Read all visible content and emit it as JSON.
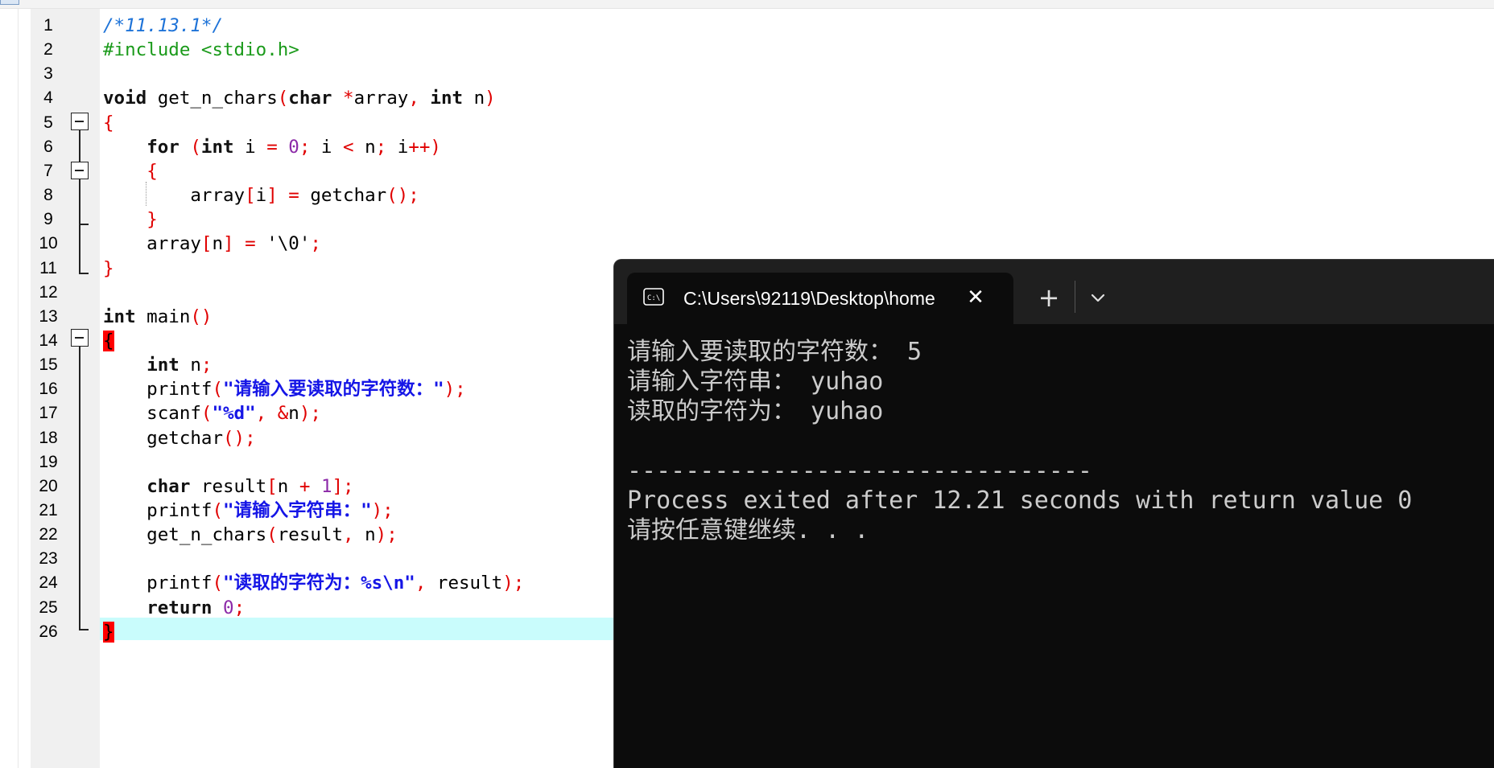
{
  "editor": {
    "lines": [
      {
        "n": "1",
        "tokens": [
          {
            "t": "/*11.13.1*/",
            "c": "comment"
          }
        ]
      },
      {
        "n": "2",
        "tokens": [
          {
            "t": "#include <stdio.h>",
            "c": "pre"
          }
        ]
      },
      {
        "n": "3",
        "tokens": []
      },
      {
        "n": "4",
        "tokens": [
          {
            "t": "void",
            "c": "kw"
          },
          {
            "t": " get_n_chars",
            "c": ""
          },
          {
            "t": "(",
            "c": "sym"
          },
          {
            "t": "char",
            "c": "kw"
          },
          {
            "t": " ",
            "c": ""
          },
          {
            "t": "*",
            "c": "sym"
          },
          {
            "t": "array",
            "c": ""
          },
          {
            "t": ", ",
            "c": "sym"
          },
          {
            "t": "int",
            "c": "kw"
          },
          {
            "t": " n",
            "c": ""
          },
          {
            "t": ")",
            "c": "sym"
          }
        ]
      },
      {
        "n": "5",
        "tokens": [
          {
            "t": "{",
            "c": "sym"
          }
        ]
      },
      {
        "n": "6",
        "tokens": [
          {
            "t": "    ",
            "c": ""
          },
          {
            "t": "for",
            "c": "kw"
          },
          {
            "t": " ",
            "c": ""
          },
          {
            "t": "(",
            "c": "sym"
          },
          {
            "t": "int",
            "c": "kw"
          },
          {
            "t": " i ",
            "c": ""
          },
          {
            "t": "=",
            "c": "sym"
          },
          {
            "t": " ",
            "c": ""
          },
          {
            "t": "0",
            "c": "num"
          },
          {
            "t": ";",
            "c": "sym"
          },
          {
            "t": " i ",
            "c": ""
          },
          {
            "t": "<",
            "c": "sym"
          },
          {
            "t": " n",
            "c": ""
          },
          {
            "t": ";",
            "c": "sym"
          },
          {
            "t": " i",
            "c": ""
          },
          {
            "t": "++)",
            "c": "sym"
          }
        ]
      },
      {
        "n": "7",
        "tokens": [
          {
            "t": "    ",
            "c": ""
          },
          {
            "t": "{",
            "c": "sym"
          }
        ]
      },
      {
        "n": "8",
        "tokens": [
          {
            "t": "        array",
            "c": ""
          },
          {
            "t": "[",
            "c": "sym"
          },
          {
            "t": "i",
            "c": ""
          },
          {
            "t": "]",
            "c": "sym"
          },
          {
            "t": " ",
            "c": ""
          },
          {
            "t": "=",
            "c": "sym"
          },
          {
            "t": " getchar",
            "c": ""
          },
          {
            "t": "();",
            "c": "sym"
          }
        ]
      },
      {
        "n": "9",
        "tokens": [
          {
            "t": "    ",
            "c": ""
          },
          {
            "t": "}",
            "c": "sym"
          }
        ]
      },
      {
        "n": "10",
        "tokens": [
          {
            "t": "    array",
            "c": ""
          },
          {
            "t": "[",
            "c": "sym"
          },
          {
            "t": "n",
            "c": ""
          },
          {
            "t": "]",
            "c": "sym"
          },
          {
            "t": " ",
            "c": ""
          },
          {
            "t": "=",
            "c": "sym"
          },
          {
            "t": " '\\0'",
            "c": ""
          },
          {
            "t": ";",
            "c": "sym"
          }
        ]
      },
      {
        "n": "11",
        "tokens": [
          {
            "t": "}",
            "c": "sym"
          }
        ]
      },
      {
        "n": "12",
        "tokens": []
      },
      {
        "n": "13",
        "tokens": [
          {
            "t": "int",
            "c": "kw"
          },
          {
            "t": " main",
            "c": ""
          },
          {
            "t": "()",
            "c": "sym"
          }
        ]
      },
      {
        "n": "14",
        "tokens": [
          {
            "t": "{",
            "c": "brace"
          }
        ]
      },
      {
        "n": "15",
        "tokens": [
          {
            "t": "    ",
            "c": ""
          },
          {
            "t": "int",
            "c": "kw"
          },
          {
            "t": " n",
            "c": ""
          },
          {
            "t": ";",
            "c": "sym"
          }
        ]
      },
      {
        "n": "16",
        "tokens": [
          {
            "t": "    printf",
            "c": ""
          },
          {
            "t": "(",
            "c": "sym"
          },
          {
            "t": "\"",
            "c": "str"
          },
          {
            "t": "请输入要读取的字符数：",
            "c": "strcjk"
          },
          {
            "t": "\"",
            "c": "str"
          },
          {
            "t": ");",
            "c": "sym"
          }
        ]
      },
      {
        "n": "17",
        "tokens": [
          {
            "t": "    scanf",
            "c": ""
          },
          {
            "t": "(",
            "c": "sym"
          },
          {
            "t": "\"%d\"",
            "c": "str"
          },
          {
            "t": ", &",
            "c": "sym"
          },
          {
            "t": "n",
            "c": ""
          },
          {
            "t": ");",
            "c": "sym"
          }
        ]
      },
      {
        "n": "18",
        "tokens": [
          {
            "t": "    getchar",
            "c": ""
          },
          {
            "t": "();",
            "c": "sym"
          }
        ]
      },
      {
        "n": "19",
        "tokens": []
      },
      {
        "n": "20",
        "tokens": [
          {
            "t": "    ",
            "c": ""
          },
          {
            "t": "char",
            "c": "kw"
          },
          {
            "t": " result",
            "c": ""
          },
          {
            "t": "[",
            "c": "sym"
          },
          {
            "t": "n ",
            "c": ""
          },
          {
            "t": "+",
            "c": "sym"
          },
          {
            "t": " ",
            "c": ""
          },
          {
            "t": "1",
            "c": "num"
          },
          {
            "t": "];",
            "c": "sym"
          }
        ]
      },
      {
        "n": "21",
        "tokens": [
          {
            "t": "    printf",
            "c": ""
          },
          {
            "t": "(",
            "c": "sym"
          },
          {
            "t": "\"",
            "c": "str"
          },
          {
            "t": "请输入字符串：",
            "c": "strcjk"
          },
          {
            "t": "\"",
            "c": "str"
          },
          {
            "t": ");",
            "c": "sym"
          }
        ]
      },
      {
        "n": "22",
        "tokens": [
          {
            "t": "    get_n_chars",
            "c": ""
          },
          {
            "t": "(",
            "c": "sym"
          },
          {
            "t": "result",
            "c": ""
          },
          {
            "t": ", ",
            "c": "sym"
          },
          {
            "t": "n",
            "c": ""
          },
          {
            "t": ");",
            "c": "sym"
          }
        ]
      },
      {
        "n": "23",
        "tokens": []
      },
      {
        "n": "24",
        "tokens": [
          {
            "t": "    printf",
            "c": ""
          },
          {
            "t": "(",
            "c": "sym"
          },
          {
            "t": "\"",
            "c": "str"
          },
          {
            "t": "读取的字符为：",
            "c": "strcjk"
          },
          {
            "t": "%s\\n\"",
            "c": "str"
          },
          {
            "t": ", ",
            "c": "sym"
          },
          {
            "t": "result",
            "c": ""
          },
          {
            "t": ");",
            "c": "sym"
          }
        ]
      },
      {
        "n": "25",
        "tokens": [
          {
            "t": "    ",
            "c": ""
          },
          {
            "t": "return",
            "c": "kw"
          },
          {
            "t": " ",
            "c": ""
          },
          {
            "t": "0",
            "c": "num"
          },
          {
            "t": ";",
            "c": "sym"
          }
        ]
      },
      {
        "n": "26",
        "tokens": [
          {
            "t": "}",
            "c": "brace"
          }
        ]
      }
    ],
    "current_line": "26"
  },
  "terminal": {
    "tab_title": "C:\\Users\\92119\\Desktop\\home",
    "tab_icon": "console-icon",
    "close_label": "✕",
    "new_tab_label": "+",
    "dropdown_icon": "chevron-down-icon",
    "output": [
      "请输入要读取的字符数： 5",
      "请输入字符串： yuhao",
      "读取的字符为： yuhao",
      "",
      "--------------------------------",
      "Process exited after 12.21 seconds with return value 0",
      "请按任意键继续. . ."
    ]
  }
}
